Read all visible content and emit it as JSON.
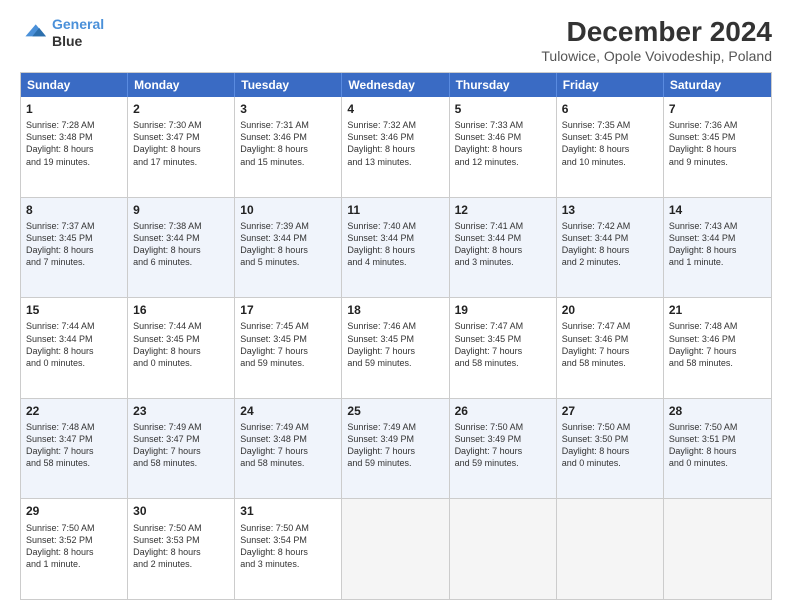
{
  "header": {
    "logo_line1": "General",
    "logo_line2": "Blue",
    "main_title": "December 2024",
    "subtitle": "Tulowice, Opole Voivodeship, Poland"
  },
  "days_of_week": [
    "Sunday",
    "Monday",
    "Tuesday",
    "Wednesday",
    "Thursday",
    "Friday",
    "Saturday"
  ],
  "rows": [
    {
      "alt": false,
      "cells": [
        {
          "day": "1",
          "lines": [
            "Sunrise: 7:28 AM",
            "Sunset: 3:48 PM",
            "Daylight: 8 hours",
            "and 19 minutes."
          ]
        },
        {
          "day": "2",
          "lines": [
            "Sunrise: 7:30 AM",
            "Sunset: 3:47 PM",
            "Daylight: 8 hours",
            "and 17 minutes."
          ]
        },
        {
          "day": "3",
          "lines": [
            "Sunrise: 7:31 AM",
            "Sunset: 3:46 PM",
            "Daylight: 8 hours",
            "and 15 minutes."
          ]
        },
        {
          "day": "4",
          "lines": [
            "Sunrise: 7:32 AM",
            "Sunset: 3:46 PM",
            "Daylight: 8 hours",
            "and 13 minutes."
          ]
        },
        {
          "day": "5",
          "lines": [
            "Sunrise: 7:33 AM",
            "Sunset: 3:46 PM",
            "Daylight: 8 hours",
            "and 12 minutes."
          ]
        },
        {
          "day": "6",
          "lines": [
            "Sunrise: 7:35 AM",
            "Sunset: 3:45 PM",
            "Daylight: 8 hours",
            "and 10 minutes."
          ]
        },
        {
          "day": "7",
          "lines": [
            "Sunrise: 7:36 AM",
            "Sunset: 3:45 PM",
            "Daylight: 8 hours",
            "and 9 minutes."
          ]
        }
      ]
    },
    {
      "alt": true,
      "cells": [
        {
          "day": "8",
          "lines": [
            "Sunrise: 7:37 AM",
            "Sunset: 3:45 PM",
            "Daylight: 8 hours",
            "and 7 minutes."
          ]
        },
        {
          "day": "9",
          "lines": [
            "Sunrise: 7:38 AM",
            "Sunset: 3:44 PM",
            "Daylight: 8 hours",
            "and 6 minutes."
          ]
        },
        {
          "day": "10",
          "lines": [
            "Sunrise: 7:39 AM",
            "Sunset: 3:44 PM",
            "Daylight: 8 hours",
            "and 5 minutes."
          ]
        },
        {
          "day": "11",
          "lines": [
            "Sunrise: 7:40 AM",
            "Sunset: 3:44 PM",
            "Daylight: 8 hours",
            "and 4 minutes."
          ]
        },
        {
          "day": "12",
          "lines": [
            "Sunrise: 7:41 AM",
            "Sunset: 3:44 PM",
            "Daylight: 8 hours",
            "and 3 minutes."
          ]
        },
        {
          "day": "13",
          "lines": [
            "Sunrise: 7:42 AM",
            "Sunset: 3:44 PM",
            "Daylight: 8 hours",
            "and 2 minutes."
          ]
        },
        {
          "day": "14",
          "lines": [
            "Sunrise: 7:43 AM",
            "Sunset: 3:44 PM",
            "Daylight: 8 hours",
            "and 1 minute."
          ]
        }
      ]
    },
    {
      "alt": false,
      "cells": [
        {
          "day": "15",
          "lines": [
            "Sunrise: 7:44 AM",
            "Sunset: 3:44 PM",
            "Daylight: 8 hours",
            "and 0 minutes."
          ]
        },
        {
          "day": "16",
          "lines": [
            "Sunrise: 7:44 AM",
            "Sunset: 3:45 PM",
            "Daylight: 8 hours",
            "and 0 minutes."
          ]
        },
        {
          "day": "17",
          "lines": [
            "Sunrise: 7:45 AM",
            "Sunset: 3:45 PM",
            "Daylight: 7 hours",
            "and 59 minutes."
          ]
        },
        {
          "day": "18",
          "lines": [
            "Sunrise: 7:46 AM",
            "Sunset: 3:45 PM",
            "Daylight: 7 hours",
            "and 59 minutes."
          ]
        },
        {
          "day": "19",
          "lines": [
            "Sunrise: 7:47 AM",
            "Sunset: 3:45 PM",
            "Daylight: 7 hours",
            "and 58 minutes."
          ]
        },
        {
          "day": "20",
          "lines": [
            "Sunrise: 7:47 AM",
            "Sunset: 3:46 PM",
            "Daylight: 7 hours",
            "and 58 minutes."
          ]
        },
        {
          "day": "21",
          "lines": [
            "Sunrise: 7:48 AM",
            "Sunset: 3:46 PM",
            "Daylight: 7 hours",
            "and 58 minutes."
          ]
        }
      ]
    },
    {
      "alt": true,
      "cells": [
        {
          "day": "22",
          "lines": [
            "Sunrise: 7:48 AM",
            "Sunset: 3:47 PM",
            "Daylight: 7 hours",
            "and 58 minutes."
          ]
        },
        {
          "day": "23",
          "lines": [
            "Sunrise: 7:49 AM",
            "Sunset: 3:47 PM",
            "Daylight: 7 hours",
            "and 58 minutes."
          ]
        },
        {
          "day": "24",
          "lines": [
            "Sunrise: 7:49 AM",
            "Sunset: 3:48 PM",
            "Daylight: 7 hours",
            "and 58 minutes."
          ]
        },
        {
          "day": "25",
          "lines": [
            "Sunrise: 7:49 AM",
            "Sunset: 3:49 PM",
            "Daylight: 7 hours",
            "and 59 minutes."
          ]
        },
        {
          "day": "26",
          "lines": [
            "Sunrise: 7:50 AM",
            "Sunset: 3:49 PM",
            "Daylight: 7 hours",
            "and 59 minutes."
          ]
        },
        {
          "day": "27",
          "lines": [
            "Sunrise: 7:50 AM",
            "Sunset: 3:50 PM",
            "Daylight: 8 hours",
            "and 0 minutes."
          ]
        },
        {
          "day": "28",
          "lines": [
            "Sunrise: 7:50 AM",
            "Sunset: 3:51 PM",
            "Daylight: 8 hours",
            "and 0 minutes."
          ]
        }
      ]
    },
    {
      "alt": false,
      "cells": [
        {
          "day": "29",
          "lines": [
            "Sunrise: 7:50 AM",
            "Sunset: 3:52 PM",
            "Daylight: 8 hours",
            "and 1 minute."
          ]
        },
        {
          "day": "30",
          "lines": [
            "Sunrise: 7:50 AM",
            "Sunset: 3:53 PM",
            "Daylight: 8 hours",
            "and 2 minutes."
          ]
        },
        {
          "day": "31",
          "lines": [
            "Sunrise: 7:50 AM",
            "Sunset: 3:54 PM",
            "Daylight: 8 hours",
            "and 3 minutes."
          ]
        },
        {
          "day": "",
          "lines": []
        },
        {
          "day": "",
          "lines": []
        },
        {
          "day": "",
          "lines": []
        },
        {
          "day": "",
          "lines": []
        }
      ]
    }
  ]
}
